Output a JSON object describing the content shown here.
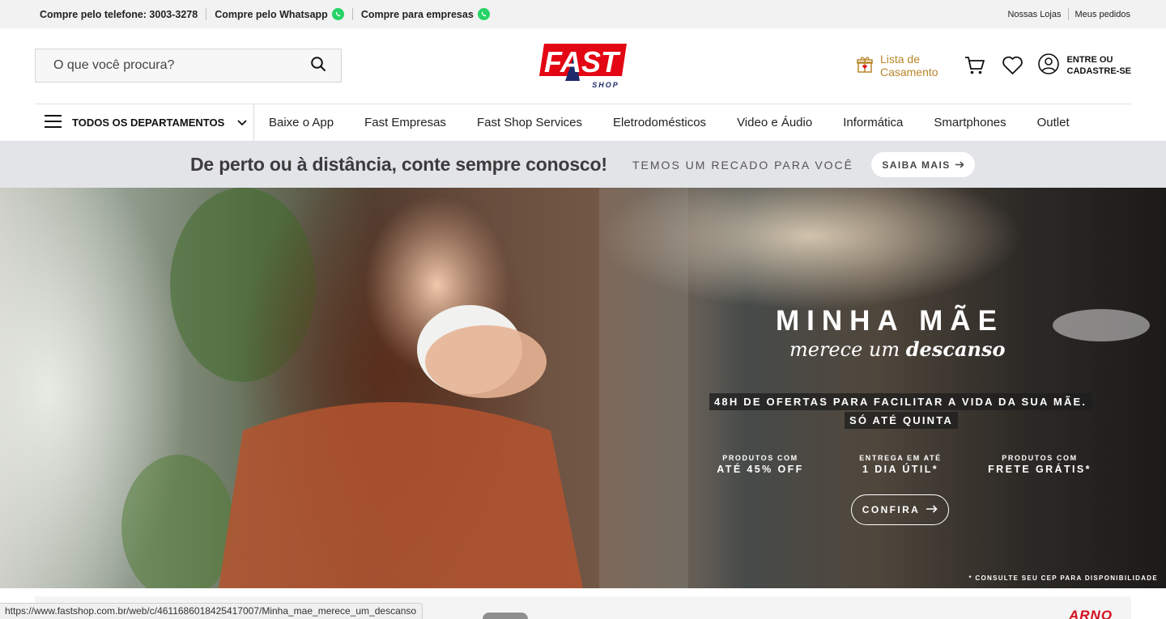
{
  "topbar": {
    "phone": "Compre pelo telefone: 3003-3278",
    "whatsapp": "Compre pelo Whatsapp",
    "business": "Compre para empresas",
    "stores": "Nossas Lojas",
    "orders": "Meus pedidos"
  },
  "header": {
    "search_placeholder": "O que você procura?",
    "logo_text": "FAST",
    "logo_sub": "SHOP",
    "wedding_line1": "Lista de",
    "wedding_line2": "Casamento",
    "account_line1": "ENTRE OU",
    "account_line2": "CADASTRE-SE"
  },
  "nav": {
    "departments": "TODOS OS DEPARTAMENTOS",
    "links": [
      "Baixe o App",
      "Fast Empresas",
      "Fast Shop Services",
      "Eletrodomésticos",
      "Video e Áudio",
      "Informática",
      "Smartphones",
      "Outlet"
    ]
  },
  "notice": {
    "headline": "De perto ou à distância, conte sempre conosco!",
    "sub": "TEMOS UM RECADO PARA VOCÊ",
    "button": "SAIBA MAIS"
  },
  "hero": {
    "title": "MINHA MÃE",
    "subtitle_pre": "merece um ",
    "subtitle_bold": "descanso",
    "offer_line1": "48H DE OFERTAS PARA FACILITAR A VIDA DA SUA MÃE.",
    "offer_line2": "SÓ ATÉ QUINTA",
    "features": [
      {
        "top": "PRODUTOS COM",
        "bottom": "ATÉ 45% OFF"
      },
      {
        "top": "ENTREGA EM ATÉ",
        "bottom": "1 DIA ÚTIL*"
      },
      {
        "top": "PRODUTOS COM",
        "bottom": "FRETE GRÁTIS*"
      }
    ],
    "cta": "CONFIRA",
    "disclaimer": "* CONSULTE SEU CEP PARA DISPONIBILIDADE"
  },
  "bottom": {
    "brand": "ARNO"
  },
  "status_url": "https://www.fastshop.com.br/web/c/4611686018425417007/Minha_mae_merece_um_descanso",
  "colors": {
    "brand_red": "#e30613",
    "brand_navy": "#1f2a6b",
    "whatsapp": "#25d366",
    "wedding_gold": "#b8862a"
  }
}
